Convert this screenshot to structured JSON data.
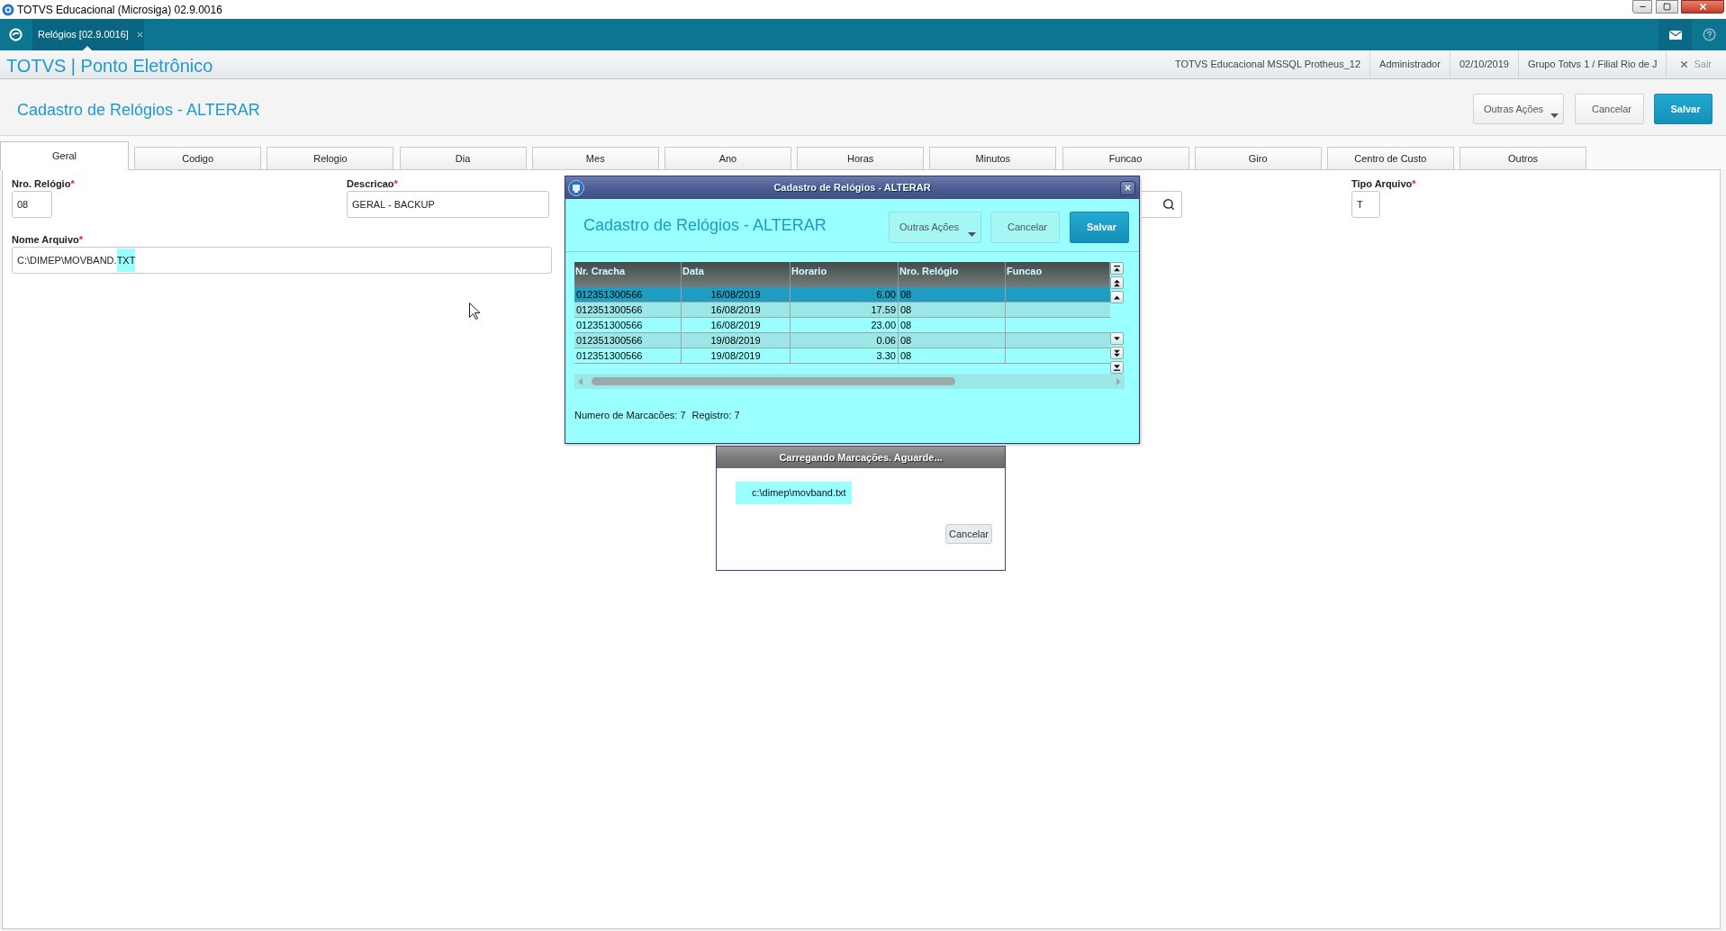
{
  "window": {
    "title": "TOTVS Educacional (Microsiga) 02.9.0016"
  },
  "app_tabs": [
    {
      "label": "Relógios [02.9.0016]",
      "selected": true
    }
  ],
  "header": {
    "title": "TOTVS | Ponto Eletrônico",
    "info": [
      "TOTVS Educacional MSSQL Protheus_12",
      "Administrador",
      "02/10/2019",
      "Grupo Totvs 1 / Filial Rio de J"
    ],
    "logout": "Sair"
  },
  "page": {
    "title": "Cadastro de Relógios - ALTERAR",
    "buttons": [
      {
        "label": "Outras Ações",
        "kind": "menu"
      },
      {
        "label": "Cancelar",
        "kind": "secondary"
      },
      {
        "label": "Salvar",
        "kind": "primary"
      }
    ]
  },
  "tabs": [
    {
      "label": "Geral",
      "selected": true
    },
    {
      "label": "Codigo",
      "selected": false
    },
    {
      "label": "Relogio",
      "selected": false
    },
    {
      "label": "Dia",
      "selected": false
    },
    {
      "label": "Mes",
      "selected": false
    },
    {
      "label": "Ano",
      "selected": false
    },
    {
      "label": "Horas",
      "selected": false
    },
    {
      "label": "Minutos",
      "selected": false
    },
    {
      "label": "Funcao",
      "selected": false
    },
    {
      "label": "Giro",
      "selected": false
    },
    {
      "label": "Centro de Custo",
      "selected": false
    },
    {
      "label": "Outros",
      "selected": false
    }
  ],
  "form": {
    "fields": [
      {
        "kind": "text",
        "label": "Nro. Relógio",
        "mark": "*",
        "value": "08"
      },
      {
        "kind": "text",
        "label": "Descricao",
        "mark": "*",
        "value": "GERAL - BACKUP"
      },
      {
        "kind": "lookup"
      },
      {
        "kind": "text",
        "label": "Tipo Arquivo",
        "mark": "*",
        "value": "T"
      },
      {
        "kind": "selection",
        "label": "Nome Arquivo",
        "mark": "*",
        "value_parts": [
          {
            "text": "C:\\DIMEP\\MOVBAND.",
            "selected": false
          },
          {
            "text": "TXT",
            "selected": true
          }
        ]
      }
    ]
  },
  "dialog": {
    "title": "Cadastro de Relógios - ALTERAR",
    "heading": "Cadastro de Relógios - ALTERAR",
    "buttons": [
      {
        "label": "Outras Ações",
        "kind": "menu"
      },
      {
        "label": "Cancelar",
        "kind": "secondary"
      },
      {
        "label": "Salvar",
        "kind": "primary"
      }
    ],
    "table": {
      "columns": [
        "Nr. Cracha",
        "Data",
        "Horario",
        "Nro. Relógio",
        "Funcao"
      ],
      "rows": [
        {
          "cracha": "012351300566",
          "data": "16/08/2019",
          "horario": "6.00",
          "relogio": "08",
          "selected": true
        },
        {
          "cracha": "012351300566",
          "data": "16/08/2019",
          "horario": "17.59",
          "relogio": "08",
          "selected": false
        },
        {
          "cracha": "012351300566",
          "data": "16/08/2019",
          "horario": "23.00",
          "relogio": "08",
          "selected": false
        },
        {
          "cracha": "012351300566",
          "data": "19/08/2019",
          "horario": "0.06",
          "relogio": "08",
          "selected": false
        },
        {
          "cracha": "012351300566",
          "data": "19/08/2019",
          "horario": "3.30",
          "relogio": "08",
          "selected": false
        }
      ]
    },
    "footer": [
      "Numero de Marcacões: 7",
      "Registro: 7"
    ]
  },
  "progress": {
    "title": "Carregando Marcações. Aguarde...",
    "file": "c:\\dimep\\movband.txt",
    "button": "Cancelar"
  }
}
